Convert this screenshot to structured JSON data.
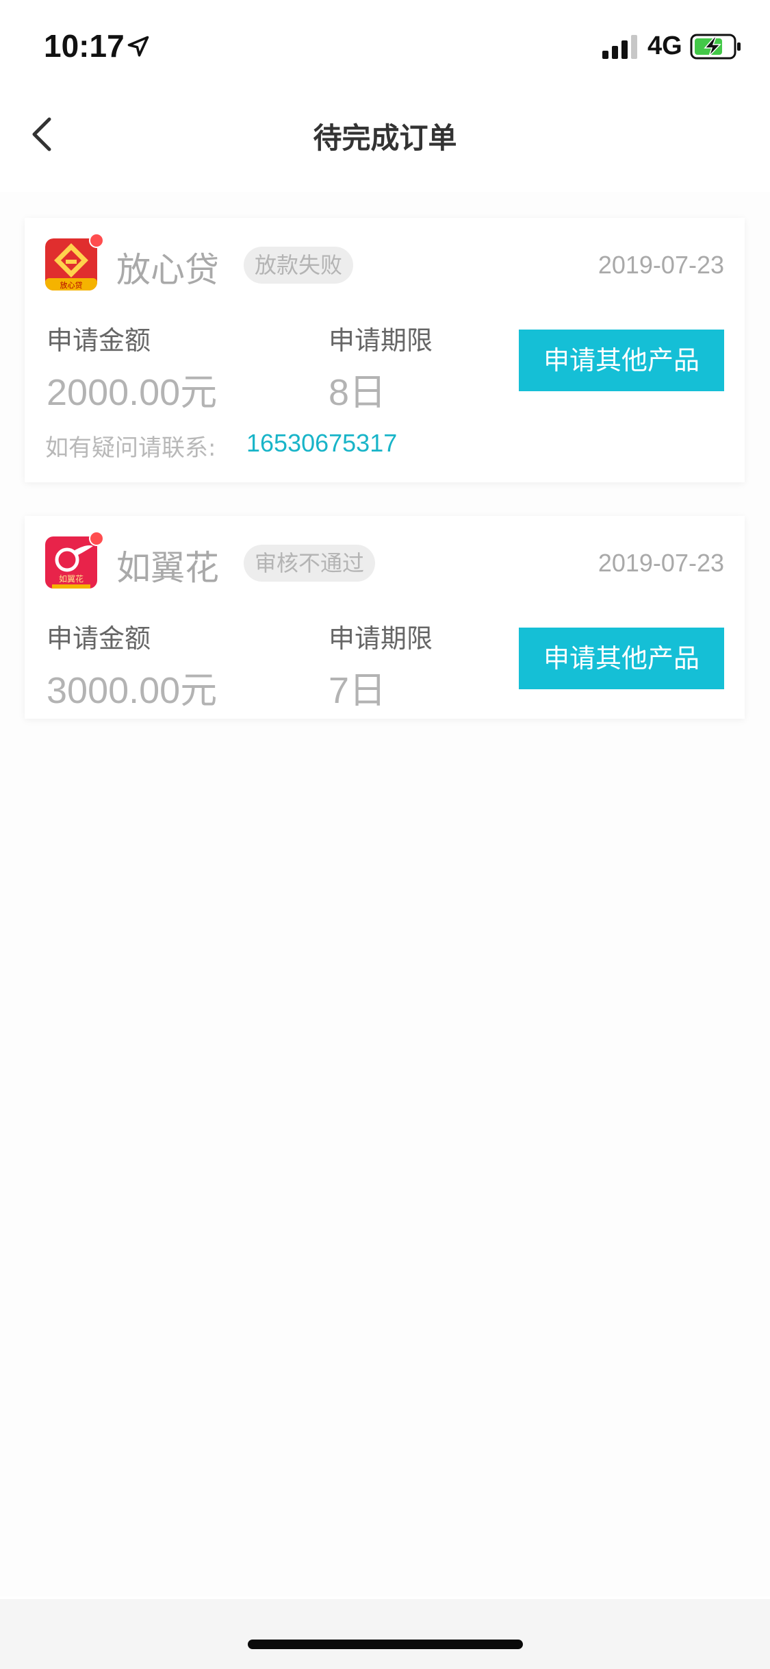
{
  "status_bar": {
    "time": "10:17",
    "network": "4G"
  },
  "header": {
    "title": "待完成订单"
  },
  "orders": [
    {
      "product_name": "放心贷",
      "logo_text": "放心贷",
      "status": "放款失败",
      "date": "2019-07-23",
      "amount_label": "申请金额",
      "amount": "2000.00元",
      "term_label": "申请期限",
      "term": "8日",
      "action_label": "申请其他产品",
      "contact_label": "如有疑问请联系:",
      "contact_phone": "16530675317",
      "logo_color": "#e02e2e"
    },
    {
      "product_name": "如翼花",
      "logo_text": "如翼花",
      "status": "审核不通过",
      "date": "2019-07-23",
      "amount_label": "申请金额",
      "amount": "3000.00元",
      "term_label": "申请期限",
      "term": "7日",
      "action_label": "申请其他产品",
      "logo_color": "#e8234a"
    }
  ],
  "colors": {
    "accent": "#15bfd6",
    "phone_link": "#18b4c8",
    "badge_bg": "#ededed"
  },
  "icons": {
    "location": "location-arrow-icon",
    "signal": "cellular-signal-icon",
    "battery": "battery-charging-icon",
    "back": "chevron-left-icon"
  }
}
